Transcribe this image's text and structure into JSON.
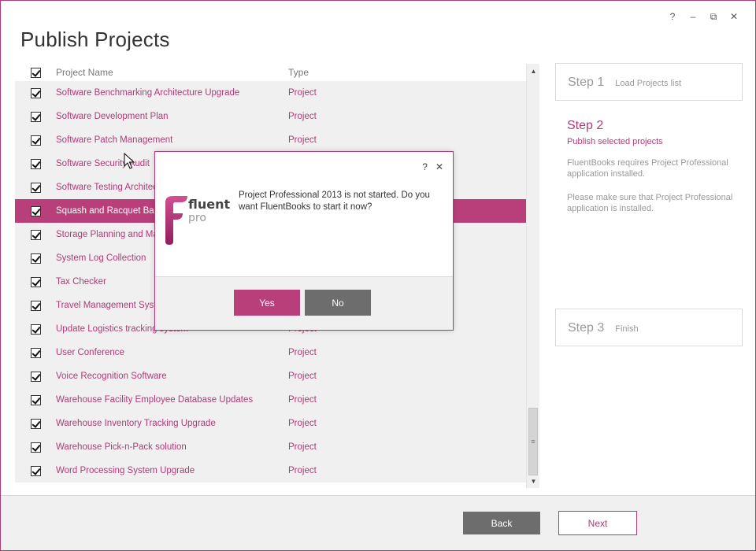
{
  "window": {
    "title": "Publish Projects",
    "controls": {
      "help": "?",
      "minimize": "‒",
      "restore": "⧉",
      "close": "✕"
    }
  },
  "list": {
    "headers": {
      "name": "Project Name",
      "type": "Type"
    },
    "rows": [
      {
        "name": "Software Benchmarking Architecture Upgrade",
        "type": "Project",
        "checked": true,
        "selected": false
      },
      {
        "name": "Software Development Plan",
        "type": "Project",
        "checked": true,
        "selected": false
      },
      {
        "name": "Software Patch Management",
        "type": "Project",
        "checked": true,
        "selected": false
      },
      {
        "name": "Software Security Audit",
        "type": "",
        "checked": true,
        "selected": false
      },
      {
        "name": "Software Testing Architecture",
        "type": "",
        "checked": true,
        "selected": false
      },
      {
        "name": "Squash and Racquet Ball",
        "type": "",
        "checked": true,
        "selected": true
      },
      {
        "name": "Storage Planning and Management",
        "type": "",
        "checked": true,
        "selected": false
      },
      {
        "name": "System Log Collection",
        "type": "",
        "checked": true,
        "selected": false
      },
      {
        "name": "Tax Checker",
        "type": "",
        "checked": true,
        "selected": false
      },
      {
        "name": "Travel Management System",
        "type": "",
        "checked": true,
        "selected": false
      },
      {
        "name": "Update Logistics tracking system",
        "type": "Project",
        "checked": true,
        "selected": false
      },
      {
        "name": "User Conference",
        "type": "Project",
        "checked": true,
        "selected": false
      },
      {
        "name": "Voice Recognition Software",
        "type": "Project",
        "checked": true,
        "selected": false
      },
      {
        "name": "Warehouse Facility Employee Database Updates",
        "type": "Project",
        "checked": true,
        "selected": false
      },
      {
        "name": "Warehouse Inventory Tracking Upgrade",
        "type": "Project",
        "checked": true,
        "selected": false
      },
      {
        "name": "Warehouse Pick-n-Pack solution",
        "type": "Project",
        "checked": true,
        "selected": false
      },
      {
        "name": "Word Processing System Upgrade",
        "type": "Project",
        "checked": true,
        "selected": false
      }
    ]
  },
  "steps": {
    "step1": {
      "num": "Step 1",
      "label": "Load Projects list"
    },
    "step2": {
      "num": "Step 2",
      "label": "Publish selected projects",
      "note1": "FluentBooks requires Project Professional application installed.",
      "note2": "Please make sure that Project Professional application is installed."
    },
    "step3": {
      "num": "Step 3",
      "label": "Finish"
    }
  },
  "footer": {
    "back": "Back",
    "next": "Next"
  },
  "dialog": {
    "help": "?",
    "close": "✕",
    "logo_text_top": "fluent",
    "logo_text_bottom": "pro",
    "message": "Project Professional 2013 is not started. Do you want FluentBooks to start it now?",
    "yes": "Yes",
    "no": "No"
  },
  "colors": {
    "accent": "#b93f7a",
    "button_gray": "#6d6d6d",
    "panel_bg": "#f0f0f0"
  }
}
